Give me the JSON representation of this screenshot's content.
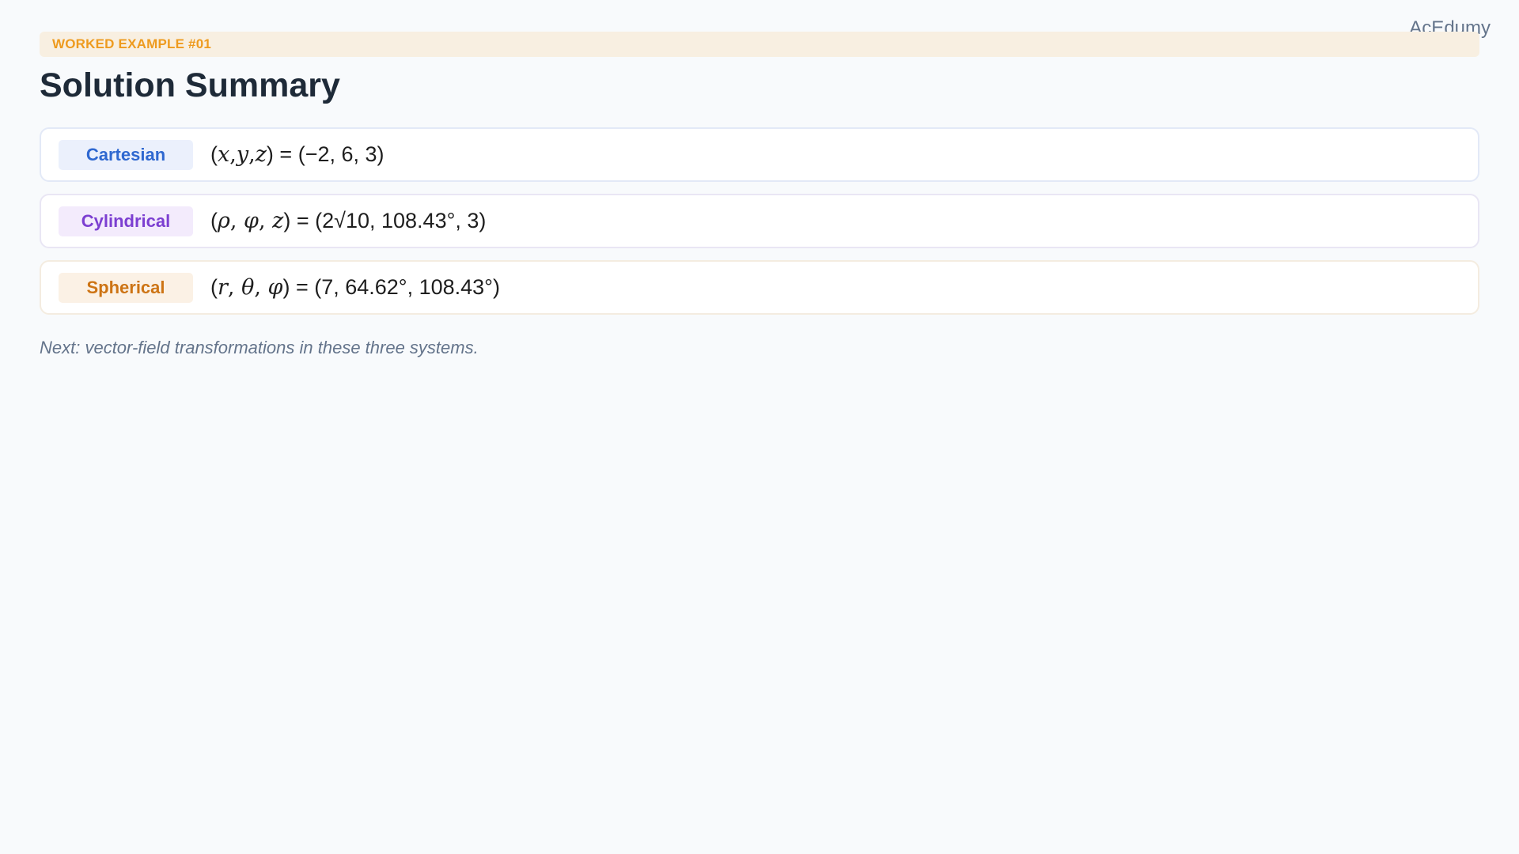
{
  "brand": "AcEdumy",
  "banner": {
    "label": "WORKED EXAMPLE #01"
  },
  "title": "Solution Summary",
  "rows": [
    {
      "system": "Cartesian",
      "open": "(",
      "variables": [
        "x",
        "y",
        "z"
      ],
      "separator": ",",
      "close": ")",
      "equals": " = ",
      "value": "(−2, 6, 3)",
      "accent": "#2f68d0"
    },
    {
      "system": "Cylindrical",
      "open": "(",
      "variables": [
        "ρ",
        "φ",
        "z"
      ],
      "separator": ", ",
      "close": ")",
      "equals": " = ",
      "value": "(2√10, 108.43°, 3)",
      "accent": "#7c3fd1"
    },
    {
      "system": "Spherical",
      "open": "(",
      "variables": [
        "r",
        "θ",
        "φ"
      ],
      "separator": ", ",
      "close": ")",
      "equals": " = ",
      "value": "(7, 64.62°, 108.43°)",
      "accent": "#cd7414"
    }
  ],
  "note": "Next: vector-field transformations in these three systems.",
  "colors": {
    "background": "#f8fafc",
    "banner_bg": "#f8efe1",
    "banner_text": "#ee9b1f",
    "title": "#1e2a38",
    "muted": "#64748b"
  }
}
